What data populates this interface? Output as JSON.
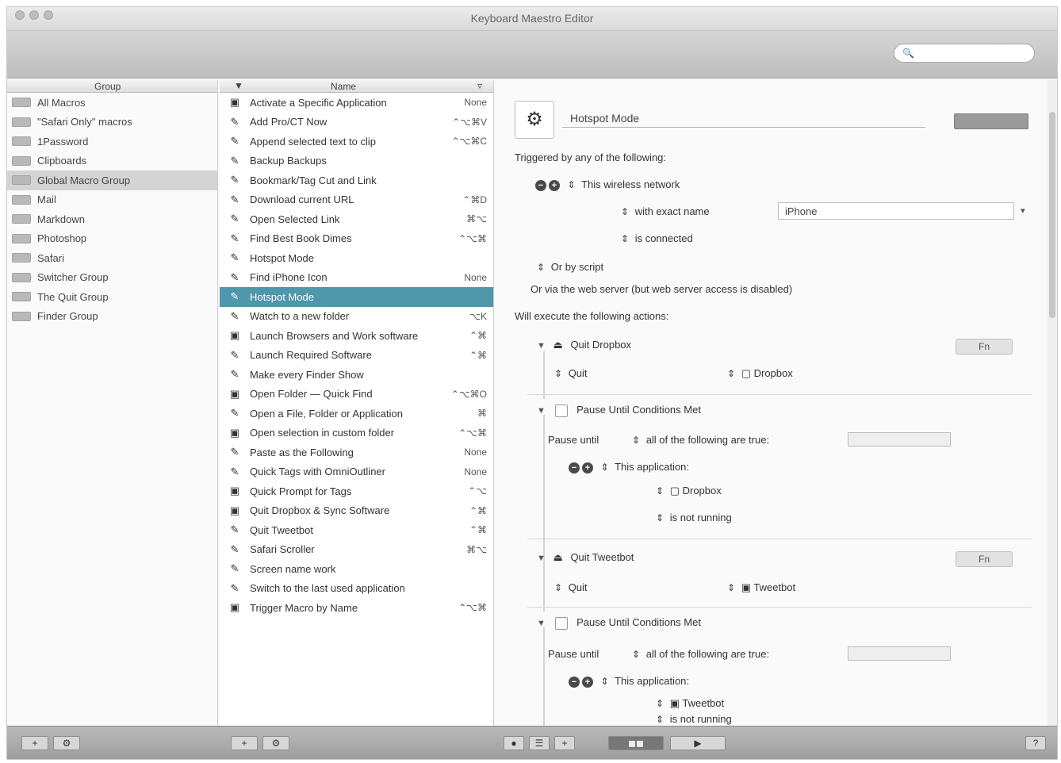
{
  "window": {
    "title": "Keyboard Maestro Editor"
  },
  "toolbar": {
    "search_placeholder": ""
  },
  "groups": {
    "header": "Group",
    "items": [
      "All Macros",
      "\"Safari Only\" macros",
      "1Password",
      "Clipboards",
      "Global Macro Group",
      "Mail",
      "Markdown",
      "Photoshop",
      "Safari",
      "Switcher Group",
      "The Quit Group",
      "Finder Group"
    ],
    "selected_index": 4
  },
  "macros": {
    "header": "Name",
    "items": [
      {
        "icon": "app-icon",
        "name": "Activate a Specific Application",
        "key": "None"
      },
      {
        "icon": "macro-icon",
        "name": "Add Pro/CT Now",
        "key": "⌃⌥⌘V"
      },
      {
        "icon": "macro-icon",
        "name": "Append selected text to clip",
        "key": "⌃⌥⌘C"
      },
      {
        "icon": "macro-icon",
        "name": "Backup Backups",
        "key": ""
      },
      {
        "icon": "macro-icon",
        "name": "Bookmark/Tag Cut and Link",
        "key": ""
      },
      {
        "icon": "macro-icon",
        "name": "Download current URL",
        "key": "⌃⌘D"
      },
      {
        "icon": "macro-icon",
        "name": "Open Selected Link",
        "key": "⌘⌥"
      },
      {
        "icon": "macro-icon",
        "name": "Find Best Book Dimes",
        "key": "⌃⌥⌘"
      },
      {
        "icon": "macro-icon",
        "name": "Hotspot Mode",
        "key": ""
      },
      {
        "icon": "macro-icon",
        "name": "Find iPhone Icon",
        "key": "None"
      },
      {
        "icon": "macro-icon",
        "name": "Hotspot Mode",
        "key": ""
      },
      {
        "icon": "macro-icon",
        "name": "Watch to a new folder",
        "key": "⌥K"
      },
      {
        "icon": "app-icon",
        "name": "Launch Browsers and Work software",
        "key": "⌃⌘"
      },
      {
        "icon": "macro-icon",
        "name": "Launch Required Software",
        "key": "⌃⌘"
      },
      {
        "icon": "macro-icon",
        "name": "Make every Finder Show",
        "key": ""
      },
      {
        "icon": "app-icon",
        "name": "Open Folder — Quick Find",
        "key": "⌃⌥⌘O"
      },
      {
        "icon": "macro-icon",
        "name": "Open a File, Folder or Application",
        "key": "⌘"
      },
      {
        "icon": "app-icon",
        "name": "Open selection in custom folder",
        "key": "⌃⌥⌘"
      },
      {
        "icon": "macro-icon",
        "name": "Paste as the Following",
        "key": "None"
      },
      {
        "icon": "macro-icon",
        "name": "Quick Tags with OmniOutliner",
        "key": "None"
      },
      {
        "icon": "app-icon",
        "name": "Quick Prompt for Tags",
        "key": "⌃⌥"
      },
      {
        "icon": "app-icon",
        "name": "Quit Dropbox & Sync Software",
        "key": "⌃⌘"
      },
      {
        "icon": "macro-icon",
        "name": "Quit Tweetbot",
        "key": "⌃⌘"
      },
      {
        "icon": "macro-icon",
        "name": "Safari Scroller",
        "key": "⌘⌥"
      },
      {
        "icon": "macro-icon",
        "name": "Screen name work",
        "key": ""
      },
      {
        "icon": "macro-icon",
        "name": "Switch to the last used application",
        "key": ""
      },
      {
        "icon": "app-icon",
        "name": "Trigger Macro by Name",
        "key": "⌃⌥⌘"
      }
    ],
    "selected_index": 10
  },
  "editor": {
    "macro_name": "Hotspot Mode",
    "enable_label": "",
    "triggered_label": "Triggered by any of the following:",
    "wireless_trigger": "This wireless network",
    "with_exact_name": "with exact name",
    "network_name": "iPhone",
    "is_connected": "is connected",
    "or_by_script": "Or by script",
    "or_via_web": "Or via the web server (but web server access is disabled)",
    "will_execute": "Will execute the following actions:",
    "action1_title": "Quit Dropbox",
    "quit_label": "Quit",
    "dropbox_app": "Dropbox",
    "pause_title": "Pause Until Conditions Met",
    "pause_until": "Pause until",
    "all_following": "all of the following are true:",
    "this_application": "This application:",
    "not_running": "is not running",
    "action2_title": "Quit Tweetbot",
    "tweetbot_app": "Tweetbot",
    "fn_label": "Fn"
  }
}
